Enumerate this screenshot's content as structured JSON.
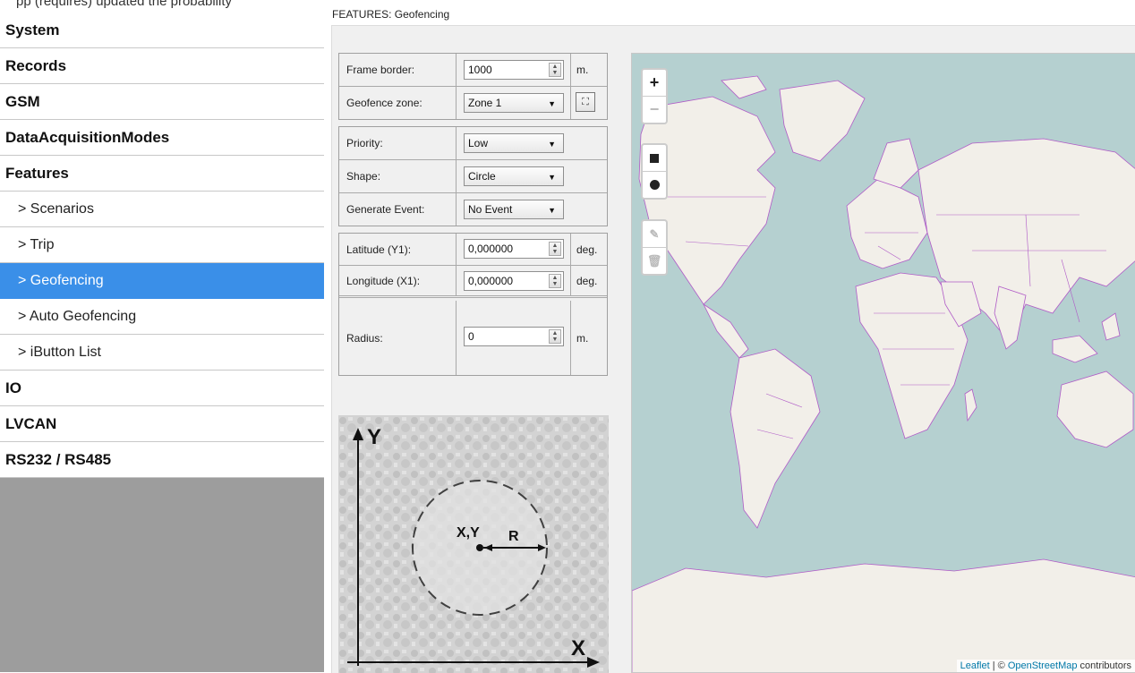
{
  "top_strip_text": "pp (requires) updated the probability",
  "sidebar": {
    "items": [
      {
        "label": "System",
        "level": "top",
        "active": false
      },
      {
        "label": "Records",
        "level": "top",
        "active": false
      },
      {
        "label": "GSM",
        "level": "top",
        "active": false
      },
      {
        "label": "DataAcquisitionModes",
        "level": "top",
        "active": false
      },
      {
        "label": "Features",
        "level": "top",
        "active": false
      },
      {
        "label": "> Scenarios",
        "level": "sub",
        "active": false
      },
      {
        "label": "> Trip",
        "level": "sub",
        "active": false
      },
      {
        "label": "> Geofencing",
        "level": "sub",
        "active": true
      },
      {
        "label": "> Auto Geofencing",
        "level": "sub",
        "active": false
      },
      {
        "label": "> iButton List",
        "level": "sub",
        "active": false
      },
      {
        "label": "IO",
        "level": "top",
        "active": false
      },
      {
        "label": "LVCAN",
        "level": "top",
        "active": false
      },
      {
        "label": "RS232 / RS485",
        "level": "top",
        "active": false
      }
    ]
  },
  "header": {
    "title": "FEATURES: Geofencing"
  },
  "form": {
    "frame_border": {
      "label": "Frame border:",
      "value": "1000",
      "unit": "m."
    },
    "geofence_zone": {
      "label": "Geofence zone:",
      "value": "Zone 1"
    },
    "priority": {
      "label": "Priority:",
      "value": "Low"
    },
    "shape": {
      "label": "Shape:",
      "value": "Circle"
    },
    "generate_event": {
      "label": "Generate Event:",
      "value": "No Event"
    },
    "latitude": {
      "label": "Latitude (Y1):",
      "value": "0,000000",
      "unit": "deg."
    },
    "longitude": {
      "label": "Longitude (X1):",
      "value": "0,000000",
      "unit": "deg."
    },
    "radius": {
      "label": "Radius:",
      "value": "0",
      "unit": "m."
    }
  },
  "diagram": {
    "y_label": "Y",
    "x_label": "X",
    "center_label": "X,Y",
    "radius_label": "R"
  },
  "map": {
    "zoom_in": "+",
    "zoom_out": "−",
    "attribution_leaflet": "Leaflet",
    "attribution_sep": " | © ",
    "attribution_osm": "OpenStreetMap",
    "attribution_tail": " contributors"
  },
  "colors": {
    "active_item": "#3a8fe8",
    "sea": "#b5d0d0",
    "land": "#f2efe9",
    "borders": "#b05bc7"
  }
}
